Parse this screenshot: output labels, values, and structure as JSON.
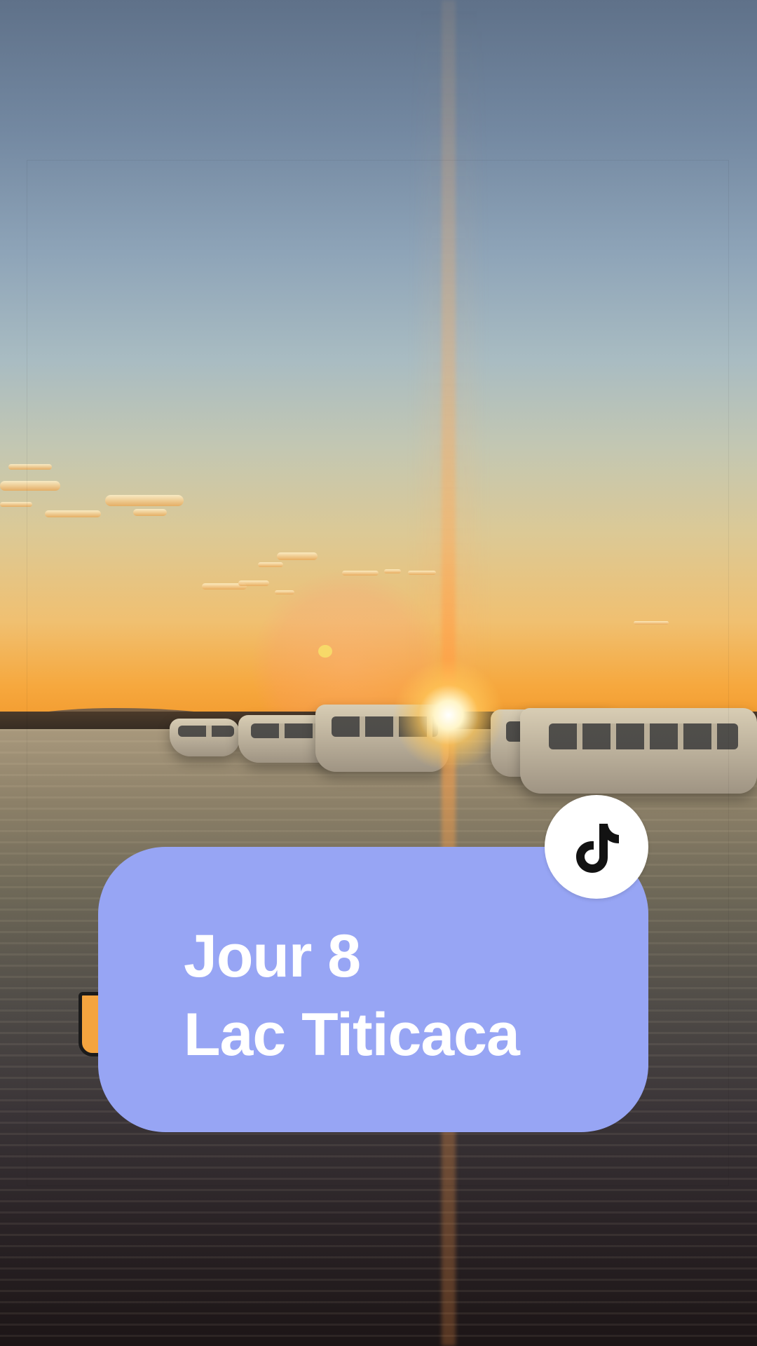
{
  "overlay": {
    "line1": "Jour 8",
    "line2": "Lac Titicaca",
    "card_color": "#97a5f4",
    "text_color": "#ffffff"
  },
  "badge": {
    "icon": "tiktok-icon",
    "background": "#ffffff",
    "icon_color": "#121212"
  }
}
